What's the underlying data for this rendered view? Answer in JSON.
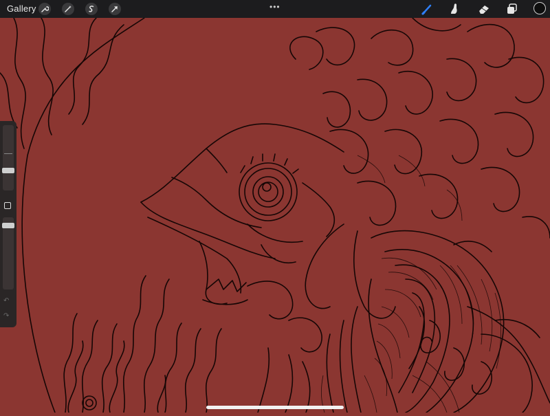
{
  "toolbar": {
    "gallery_label": "Gallery",
    "left_tools": [
      "wrench-icon",
      "magic-wand-icon",
      "selection-icon",
      "transform-arrow-icon"
    ],
    "more_label": "•••",
    "right_tools": [
      "brush-icon",
      "smudge-icon",
      "eraser-icon",
      "layers-icon"
    ],
    "active_tool": "brush-icon",
    "active_color": "#0e0e0e"
  },
  "canvas": {
    "background_color": "#8b3631",
    "line_color": "#150605"
  },
  "sidebar": {
    "controls": [
      "brush-size-slider",
      "modify-button",
      "opacity-slider",
      "undo-button",
      "redo-button"
    ]
  }
}
